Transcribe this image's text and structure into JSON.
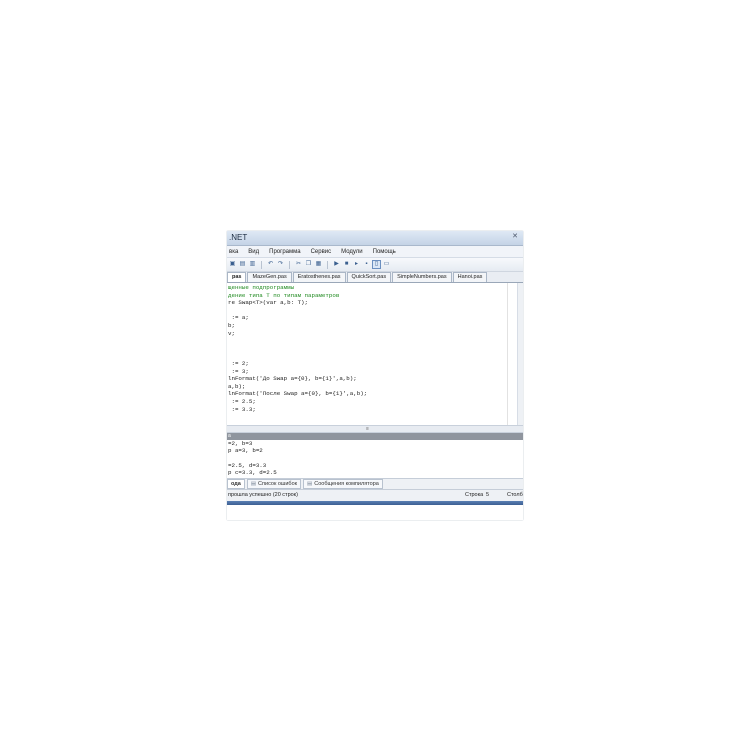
{
  "window": {
    "title": ".NET",
    "close_glyph": "✕"
  },
  "menu": [
    "вка",
    "Вид",
    "Программа",
    "Сервис",
    "Модули",
    "Помощь"
  ],
  "toolbar_icons": [
    "save-icon",
    "save-all-icon",
    "print-icon",
    "undo-icon",
    "redo-icon",
    "cut-icon",
    "copy-icon",
    "paste-icon",
    "run-icon",
    "stop-icon",
    "step-icon",
    "compile-icon",
    "toggle-view-icon",
    "layout-icon"
  ],
  "tabs": [
    {
      "label": "pas",
      "active": true
    },
    {
      "label": "MazeGen.pas"
    },
    {
      "label": "Eratosthenes.pas"
    },
    {
      "label": "QuickSort.pas"
    },
    {
      "label": "SimpleNumbers.pas"
    },
    {
      "label": "Hanoi.pas"
    }
  ],
  "editor": {
    "lines": [
      {
        "text": "щенные подпрограммы",
        "comment": true
      },
      {
        "text": "дение типа T по типам параметров",
        "comment": true
      },
      {
        "text": "re Swap<T>(var a,b: T);"
      },
      {
        "text": ""
      },
      {
        "text": " := a;"
      },
      {
        "text": "b;"
      },
      {
        "text": "v;"
      },
      {
        "text": ""
      },
      {
        "text": ""
      },
      {
        "text": ""
      },
      {
        "text": " := 2;"
      },
      {
        "text": " := 3;"
      },
      {
        "text": "lnFormat('До Swap a={0}, b={1}',a,b);"
      },
      {
        "text": "a,b);"
      },
      {
        "text": "lnFormat('После Swap a={0}, b={1}',a,b);"
      },
      {
        "text": " := 2.5;"
      },
      {
        "text": " := 3.3;"
      }
    ],
    "splitter_glyph": "≡"
  },
  "output": {
    "header": "а",
    "lines": [
      "=2, b=3",
      "р a=3, b=2",
      "",
      "=2.5, d=3.3",
      "р c=3.3, d=2.5"
    ]
  },
  "bottom_tabs": [
    {
      "label": "ода",
      "active": true
    },
    {
      "label": "Список ошибок"
    },
    {
      "label": "Сообщения компилятора"
    }
  ],
  "status": {
    "message": "прошла успешно (20 строк)",
    "row_label": "Строка",
    "row_value": "5",
    "col_label": "Столб"
  }
}
